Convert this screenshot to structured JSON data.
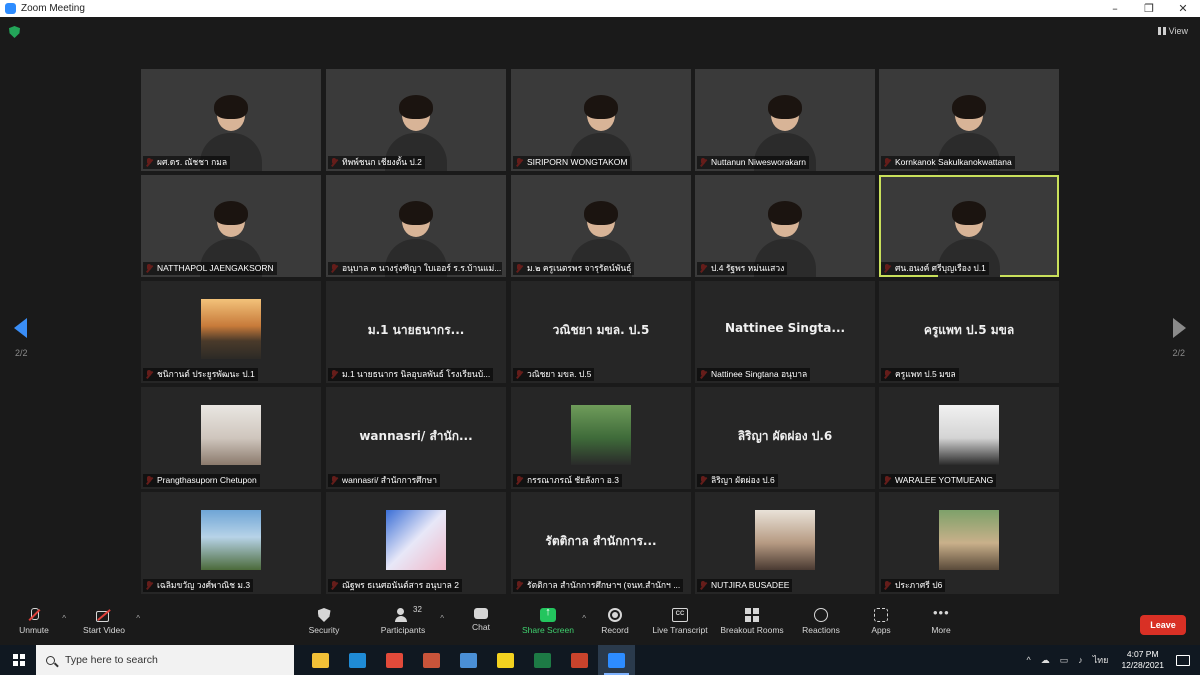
{
  "window": {
    "title": "Zoom Meeting",
    "controls": [
      "–",
      "❐",
      "✕"
    ]
  },
  "view_label": "View",
  "pager": {
    "left": "2/2",
    "right": "2/2"
  },
  "participants": [
    {
      "name": "ผศ.ดร. ณัชชา กมล",
      "type": "video",
      "bg": "bg1"
    },
    {
      "name": "ทิพพ์ชนก เชียงตั้น ป.2",
      "type": "video",
      "bg": "bg2"
    },
    {
      "name": "SIRIPORN WONGTAKOM",
      "type": "video",
      "bg": "bg3"
    },
    {
      "name": "Nuttanun Niwesworakarn",
      "type": "video",
      "bg": "bg4"
    },
    {
      "name": "Kornkanok Sakulkanokwattana",
      "type": "video",
      "bg": "bg5"
    },
    {
      "name": "NATTHAPOL JAENGAKSORN",
      "type": "video",
      "bg": "bg6"
    },
    {
      "name": "อนุบาล ๓ นางรุ่งฑิญา ใบเออร์ ร.ร.บ้านแม่...",
      "type": "video",
      "bg": "bg7"
    },
    {
      "name": "ม.๒ ครูเนตรพร จารุรัตน์พันธุ์",
      "type": "video",
      "bg": "bg8"
    },
    {
      "name": "ป.4 รัฐพร หม่นแสวง",
      "type": "video",
      "bg": "bg9"
    },
    {
      "name": "ศน.อนงค์ ศรีบุญเรือง ป.1",
      "type": "video",
      "bg": "bg10",
      "active": true
    },
    {
      "name": "ชนิกานต์ ประยูรพัฒนะ ป.1",
      "type": "photo",
      "thumb": "t1"
    },
    {
      "name": "ม.1 นายธนากร   นิลอุบลพันธ์ โรงเรียนบ้...",
      "type": "text",
      "display": "ม.1 นายธนากร..."
    },
    {
      "name": "วณิชยา มขล. ป.5",
      "type": "text",
      "display": "วณิชยา มขล. ป.5"
    },
    {
      "name": "Nattinee Singtana อนุบาล",
      "type": "text",
      "display": "Nattinee Singta..."
    },
    {
      "name": "ครูแพท ป.5 มขล",
      "type": "text",
      "display": "ครูแพท ป.5 มขล"
    },
    {
      "name": "Prangthasuporn Chetupon",
      "type": "photo",
      "thumb": "t2"
    },
    {
      "name": "wannasri/ สำนักการศึกษา",
      "type": "text",
      "display": "wannasri/ สำนัก..."
    },
    {
      "name": "กรรณาภรณ์ ชัยลังกา อ.3",
      "type": "photo",
      "thumb": "t3"
    },
    {
      "name": "ลิริญา ผัดผ่อง ป.6",
      "type": "text",
      "display": "ลิริญา ผัดผ่อง ป.6"
    },
    {
      "name": "WARALEE YOTMUEANG",
      "type": "photo",
      "thumb": "t4"
    },
    {
      "name": "เฉลิมขวัญ  วงศ์พาณิช ม.3",
      "type": "photo",
      "thumb": "t5"
    },
    {
      "name": "ณัฐพร ธเนศอนันต์สาร อนุบาล 2",
      "type": "photo",
      "thumb": "t6"
    },
    {
      "name": "รัตติกาล  สำนักการศึกษาฯ (จนท.สำนักฯ ...",
      "type": "text",
      "display": "รัตติกาล  สำนักการ..."
    },
    {
      "name": "NUTJIRA BUSADEE",
      "type": "photo",
      "thumb": "t7"
    },
    {
      "name": "ประภาศรี  ป6",
      "type": "photo",
      "thumb": "t8"
    }
  ],
  "toolbar": {
    "unmute": "Unmute",
    "start_video": "Start Video",
    "security": "Security",
    "participants": "Participants",
    "participants_count": "32",
    "chat": "Chat",
    "share_screen": "Share Screen",
    "record": "Record",
    "live_transcript": "Live Transcript",
    "breakout_rooms": "Breakout Rooms",
    "reactions": "Reactions",
    "apps": "Apps",
    "more": "More",
    "leave": "Leave",
    "accent_color": "#23c55e",
    "leave_color": "#d93025"
  },
  "taskbar": {
    "search_placeholder": "Type here to search",
    "apps": [
      {
        "name": "file-explorer-icon",
        "color": "#f2c037"
      },
      {
        "name": "edge-icon",
        "color": "#1f8bd6"
      },
      {
        "name": "chrome-icon",
        "color": "#e24a3a"
      },
      {
        "name": "app-icon",
        "color": "#c9543a"
      },
      {
        "name": "globe-icon",
        "color": "#4a8fd6"
      },
      {
        "name": "sticky-notes-icon",
        "color": "#f4d21f"
      },
      {
        "name": "excel-icon",
        "color": "#1d7a45"
      },
      {
        "name": "powerpoint-icon",
        "color": "#c9432c"
      },
      {
        "name": "zoom-icon",
        "color": "#2d8cff",
        "active": true
      }
    ],
    "language": "ไทย",
    "time": "4:07 PM",
    "date": "12/28/2021"
  }
}
